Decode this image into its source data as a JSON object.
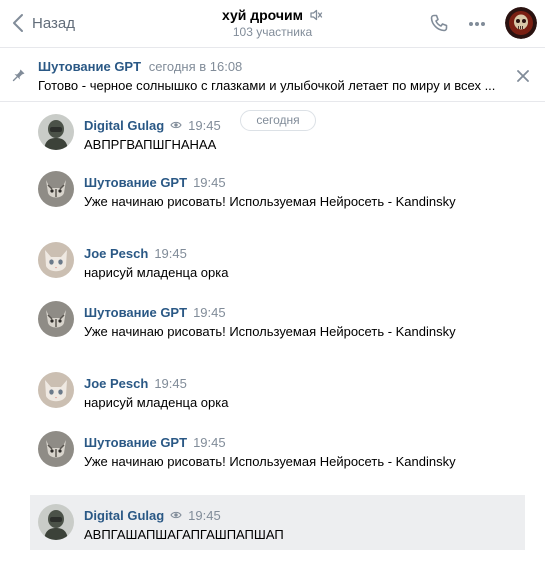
{
  "header": {
    "back_label": "Назад",
    "title": "хуй дрочим",
    "subtitle": "103 участника"
  },
  "pinned": {
    "author": "Шутование GPT",
    "time": "сегодня в 16:08",
    "text": "Готово - черное солнышко с глазками и улыбочкой летает по миру и всех ..."
  },
  "feed": {
    "date_label": "сегодня"
  },
  "messages": [
    {
      "author": "Digital Gulag",
      "time": "19:45",
      "text": "АВПРГВАПШГНАНАА",
      "seen_icon": "eye-icon"
    },
    {
      "author": "Шутование GPT",
      "time": "19:45",
      "text": "Уже начинаю рисовать! Используемая Нейросеть - Kandinsky"
    },
    {
      "author": "Joe Pesch",
      "time": "19:45",
      "text": "нарисуй младенца орка"
    },
    {
      "author": "Шутование GPT",
      "time": "19:45",
      "text": "Уже начинаю рисовать! Используемая Нейросеть - Kandinsky"
    },
    {
      "author": "Joe Pesch",
      "time": "19:45",
      "text": "нарисуй младенца орка"
    },
    {
      "author": "Шутование GPT",
      "time": "19:45",
      "text": "Уже начинаю рисовать! Используемая Нейросеть - Kandinsky"
    },
    {
      "author": "Digital Gulag",
      "time": "19:45",
      "text": "АВПГАШАПШАГАПГАШПАПШАП",
      "seen_icon": "eye-icon"
    }
  ],
  "colors": {
    "link": "#2a5885",
    "muted": "#818c99",
    "highlight": "#edeef0"
  }
}
